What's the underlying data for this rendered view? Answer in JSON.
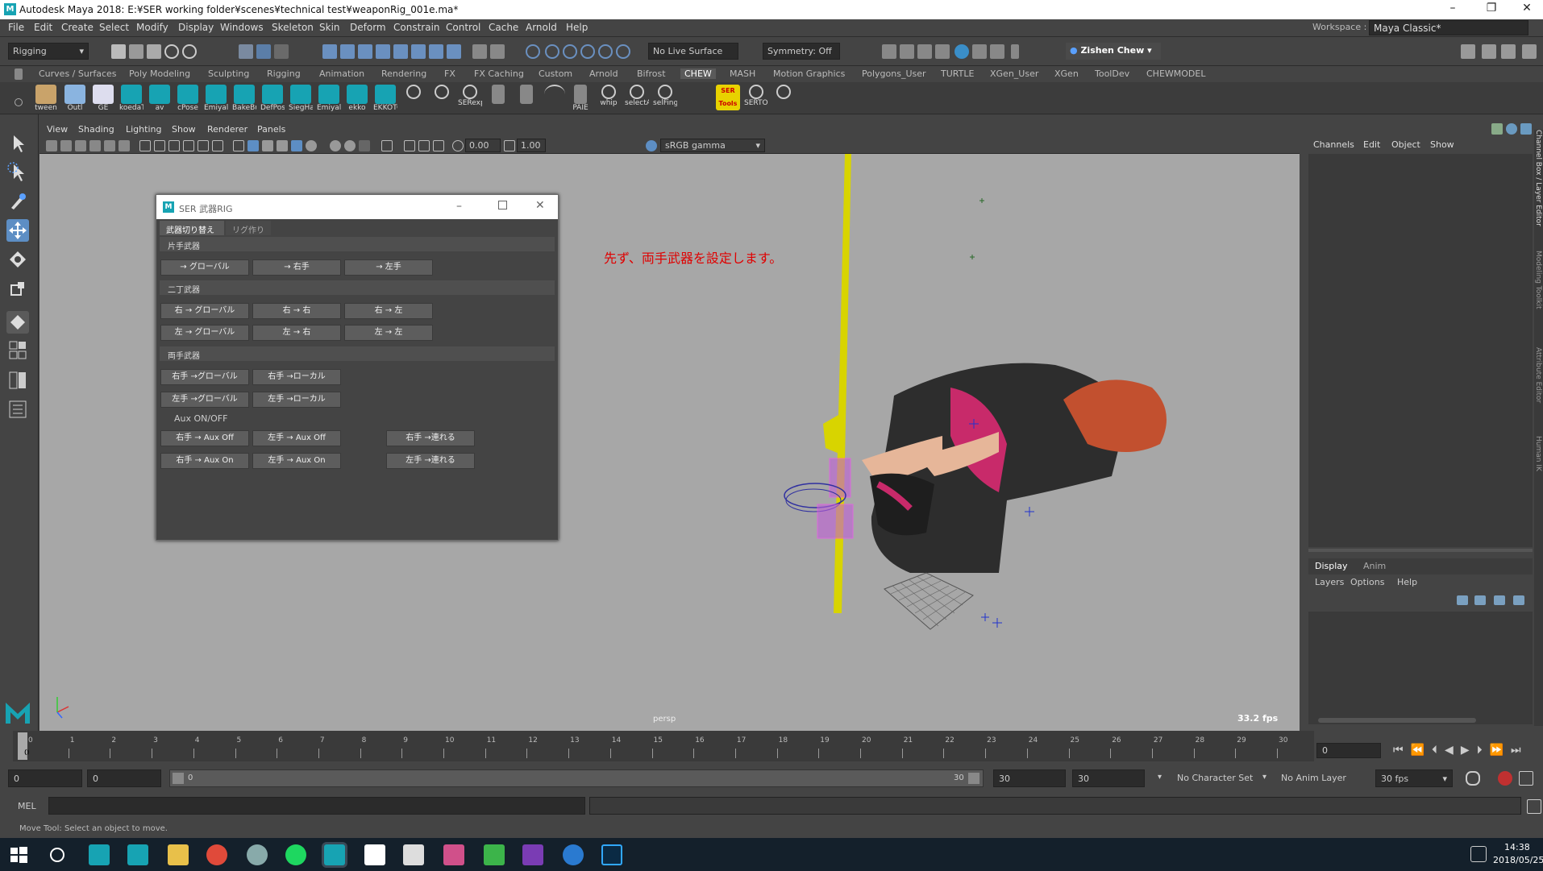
{
  "window": {
    "title": "Autodesk Maya 2018: E:¥SER working folder¥scenes¥technical test¥weaponRig_001e.ma*",
    "logo": "M"
  },
  "menu": [
    "File",
    "Edit",
    "Create",
    "Select",
    "Modify",
    "Display",
    "Windows",
    "Skeleton",
    "Skin",
    "Deform",
    "Constrain",
    "Control",
    "Cache",
    "Arnold",
    "Help"
  ],
  "workspace": {
    "label": "Workspace :",
    "value": "Maya Classic*"
  },
  "status": {
    "menuset": "Rigging",
    "live_surface": "No Live Surface",
    "symmetry": "Symmetry: Off",
    "user": "Zishen Chew"
  },
  "shelf_tabs": [
    "Curves / Surfaces",
    "Poly Modeling",
    "Sculpting",
    "Rigging",
    "Animation",
    "Rendering",
    "FX",
    "FX Caching",
    "Custom",
    "Arnold",
    "Bifrost",
    "CHEW",
    "MASH",
    "Motion Graphics",
    "Polygons_User",
    "TURTLE",
    "XGen_User",
    "XGen",
    "ToolDev",
    "CHEWMODEL"
  ],
  "shelf_active": "CHEW",
  "shelf_items": [
    "tween",
    "Outl",
    "GE",
    "koedaT",
    "av",
    "cPose",
    "Emiyalc",
    "BakeBu",
    "DefPos",
    "SiegHa",
    "Emiyalc",
    "ekko",
    "EKKOTC",
    "",
    "",
    "SERexp",
    "",
    "",
    "",
    "PAIE",
    "whip",
    "selectA",
    "selFing",
    "SER Tools",
    "SERTOC",
    ""
  ],
  "viewport": {
    "menu": [
      "View",
      "Shading",
      "Lighting",
      "Show",
      "Renderer",
      "Panels"
    ],
    "exposure": "0.00",
    "gamma": "1.00",
    "colorspace": "sRGB gamma",
    "camera": "persp",
    "fps": "33.2 fps",
    "annotation": "先ず、両手武器を設定します。"
  },
  "dialog": {
    "title": "SER 武器RIG",
    "logo": "M",
    "tabs": [
      "武器切り替え",
      "リグ作り"
    ],
    "section1": "片手武器",
    "s1_buttons": [
      "→ グローバル",
      "→ 右手",
      "→ 左手"
    ],
    "section2": "二丁武器",
    "s2_row1": [
      "右 → グローバル",
      "右 → 右",
      "右 → 左"
    ],
    "s2_row2": [
      "左 → グローバル",
      "左 → 右",
      "左 → 左"
    ],
    "section3": "両手武器",
    "s3_row1": [
      "右手 →グローバル",
      "右手 →ローカル"
    ],
    "s3_row2": [
      "左手 →グローバル",
      "左手 →ローカル"
    ],
    "aux_label": "Aux ON/OFF",
    "aux_row1": [
      "右手 → Aux Off",
      "左手 → Aux Off",
      "右手 →連れる"
    ],
    "aux_row2": [
      "右手 → Aux On",
      "左手 → Aux On",
      "左手 →連れる"
    ]
  },
  "channelbox": {
    "menu": [
      "Channels",
      "Edit",
      "Object",
      "Show"
    ],
    "side_tabs": [
      "Channel Box / Layer Editor",
      "Modeling Toolkit",
      "Attribute Editor",
      "Human IK"
    ]
  },
  "layers": {
    "tabs": [
      "Display",
      "Anim"
    ],
    "menu": [
      "Layers",
      "Options",
      "Help"
    ]
  },
  "timeline": {
    "ticks": [
      "0",
      "1",
      "2",
      "3",
      "4",
      "5",
      "6",
      "7",
      "8",
      "9",
      "10",
      "11",
      "12",
      "13",
      "14",
      "15",
      "16",
      "17",
      "18",
      "19",
      "20",
      "21",
      "22",
      "23",
      "24",
      "25",
      "26",
      "27",
      "28",
      "29",
      "30"
    ],
    "current": "0",
    "current_field": "0"
  },
  "range": {
    "start": "0",
    "playback_start": "0",
    "slider_start": "0",
    "slider_end": "30",
    "playback_end": "30",
    "end": "30",
    "character_set": "No Character Set",
    "anim_layer": "No Anim Layer",
    "fps": "30 fps"
  },
  "mel": {
    "label": "MEL"
  },
  "help_line": "Move Tool: Select an object to move.",
  "clock": {
    "time": "14:38",
    "date": "2018/05/25"
  }
}
